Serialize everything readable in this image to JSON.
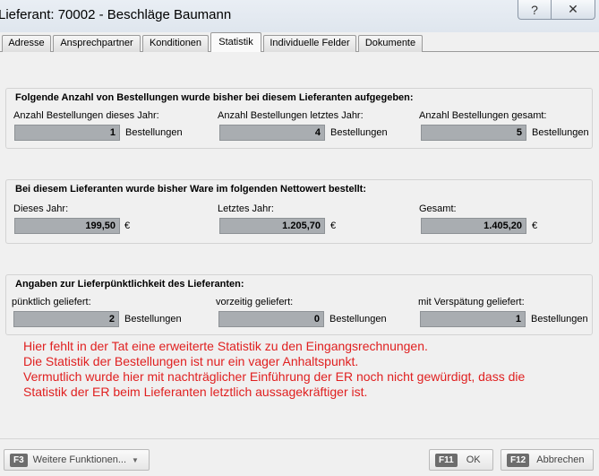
{
  "window": {
    "title": "Lieferant: 70002 - Beschläge Baumann",
    "help_glyph": "?",
    "close_glyph": "✕"
  },
  "tabs": [
    {
      "label": "Adresse"
    },
    {
      "label": "Ansprechpartner"
    },
    {
      "label": "Konditionen"
    },
    {
      "label": "Statistik",
      "active": true
    },
    {
      "label": "Individuelle Felder"
    },
    {
      "label": "Dokumente"
    }
  ],
  "orders": {
    "title": "Folgende Anzahl von Bestellungen wurde bisher bei diesem Lieferanten aufgegeben:",
    "this_year_label": "Anzahl Bestellungen dieses Jahr:",
    "this_year_value": "1",
    "last_year_label": "Anzahl Bestellungen letztes Jahr:",
    "last_year_value": "4",
    "total_label": "Anzahl Bestellungen gesamt:",
    "total_value": "5",
    "unit": "Bestellungen"
  },
  "net": {
    "title": "Bei diesem Lieferanten wurde bisher Ware im folgenden Nettowert bestellt:",
    "this_year_label": "Dieses Jahr:",
    "this_year_value": "199,50",
    "last_year_label": "Letztes Jahr:",
    "last_year_value": "1.205,70",
    "total_label": "Gesamt:",
    "total_value": "1.405,20",
    "currency": "€"
  },
  "punctuality": {
    "title": "Angaben zur Lieferpünktlichkeit des Lieferanten:",
    "on_time_label": "pünktlich geliefert:",
    "on_time_value": "2",
    "early_label": "vorzeitig geliefert:",
    "early_value": "0",
    "late_label": "mit Verspätung geliefert:",
    "late_value": "1",
    "unit": "Bestellungen"
  },
  "note": {
    "line1": "Hier fehlt in der Tat eine erweiterte Statistik zu den Eingangsrechnungen.",
    "line2": "Die Statistik der Bestellungen ist nur ein vager Anhaltspunkt.",
    "line3": "Vermutlich wurde hier mit nachträglicher Einführung der ER noch nicht gewürdigt, dass die",
    "line4": "Statistik der ER beim Lieferanten letztlich aussagekräftiger ist."
  },
  "footer": {
    "more_key": "F3",
    "more_label": "Weitere Funktionen...",
    "ok_key": "F11",
    "ok_label": "OK",
    "cancel_key": "F12",
    "cancel_label": "Abbrechen"
  }
}
